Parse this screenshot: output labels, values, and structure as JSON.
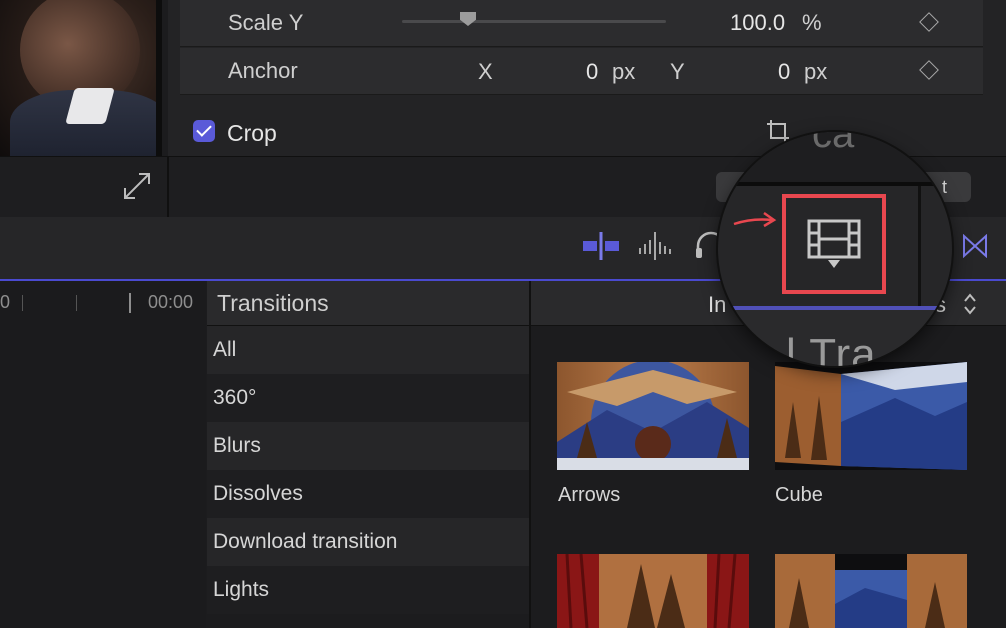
{
  "inspector": {
    "scale_y": {
      "label": "Scale Y",
      "value": "100.0",
      "unit": "%",
      "slider_fraction": 0.25
    },
    "anchor": {
      "label": "Anchor",
      "x_label": "X",
      "x_value": "0",
      "x_unit": "px",
      "y_label": "Y",
      "y_value": "0",
      "y_unit": "px"
    },
    "crop": {
      "label": "Crop",
      "checked": true
    }
  },
  "viewer": {
    "reset_label": "t"
  },
  "timeline": {
    "ruler_start": "0",
    "ruler_time": "00:00"
  },
  "browser": {
    "title": "Transitions",
    "installed_label_start": "In",
    "installed_label_end": "s",
    "categories": [
      "All",
      "360°",
      "Blurs",
      "Dissolves",
      "Download transition",
      "Lights"
    ],
    "thumbnails": [
      {
        "label": "Arrows"
      },
      {
        "label": "Cube"
      }
    ]
  },
  "magnifier": {
    "bottom_text": "l Tra",
    "top_text": "ca"
  },
  "colors": {
    "accent": "#5a5ad8",
    "highlight": "#e8474f",
    "panel": "#2c2c2e"
  }
}
